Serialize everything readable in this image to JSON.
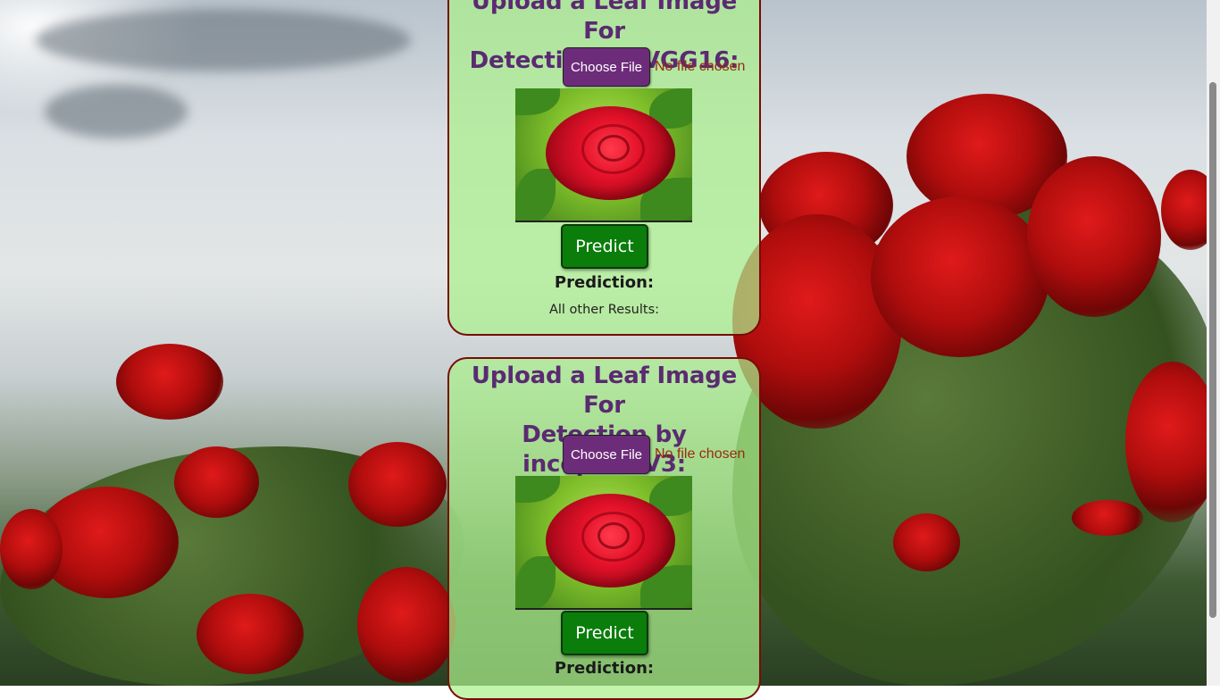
{
  "cards": [
    {
      "title_lines": [
        "Upload a Leaf Image For",
        "Detection by VGG16:"
      ],
      "choose_file_label": "Choose File",
      "file_status": "No file chosen",
      "predict_label": "Predict",
      "prediction_label": "Prediction:",
      "other_results_label": "All other Results:"
    },
    {
      "title_lines": [
        "Upload a Leaf Image For",
        "Detection by inceptionV3:"
      ],
      "choose_file_label": "Choose File",
      "file_status": "No file chosen",
      "predict_label": "Predict",
      "prediction_label": "Prediction:"
    }
  ],
  "icons": {
    "background": "rose-garden-background",
    "preview": "red-rose-preview-image"
  },
  "colors": {
    "title": "#5b2a72",
    "choose_file_button": "#6d2c7a",
    "predict_button": "#0a7d0a",
    "card_border": "#7a0a0a",
    "file_status": "#9a2a10"
  }
}
